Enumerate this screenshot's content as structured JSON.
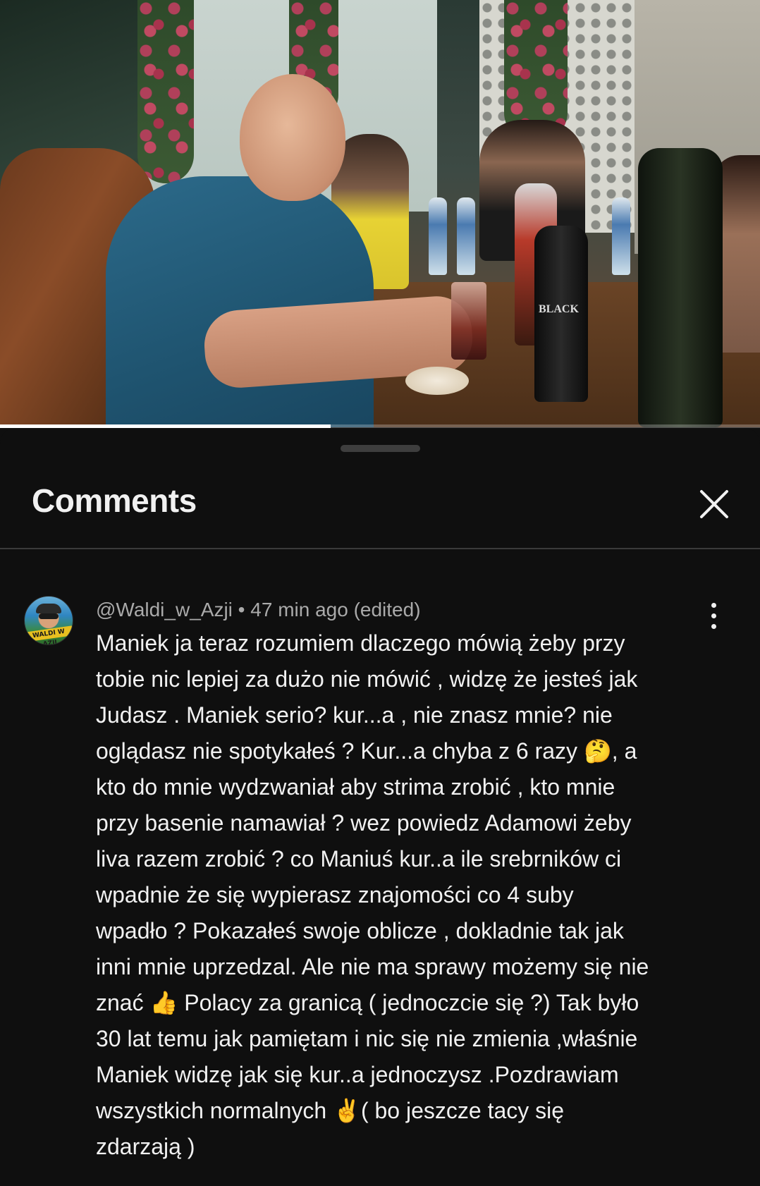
{
  "video": {
    "progress_fraction": 0.435,
    "bottle_label": "BLACK"
  },
  "comments_panel": {
    "title": "Comments",
    "close_icon": "close-icon"
  },
  "comment": {
    "author": "@Waldi_w_Azji",
    "separator": "•",
    "time": "47 min ago (edited)",
    "avatar_text": "WALDI W AZJI",
    "menu_icon": "more-vert-icon",
    "lines": [
      "Maniek ja teraz rozumiem dlaczego mówią żeby przy",
      "tobie nic lepiej za dużo nie mówić , widzę że jesteś jak",
      "Judasz . Maniek serio? kur...a ,  nie znasz mnie? nie",
      "oglądasz nie spotykałeś ? Kur...a chyba z 6 razy  🤔, a",
      "kto do mnie wydzwaniał aby strima zrobić , kto mnie",
      "przy basenie namawiał ? wez powiedz Adamowi żeby",
      "liva razem zrobić ? co Maniuś kur..a ile srebrników ci",
      "wpadnie że się wypierasz znajomości co 4 suby",
      "wpadło ? Pokazałeś swoje oblicze , dokladnie tak jak",
      "inni mnie uprzedzal. Ale nie ma sprawy możemy się nie",
      "znać 👍 Polacy za granicą ( jednoczcie się ?) Tak było",
      "30 lat temu jak pamiętam i nic się nie zmienia ,właśnie",
      "Maniek widzę jak się kur..a jednoczysz  .Pozdrawiam",
      "wszystkich normalnych ✌️( bo jeszcze tacy się",
      "zdarzają )"
    ]
  }
}
